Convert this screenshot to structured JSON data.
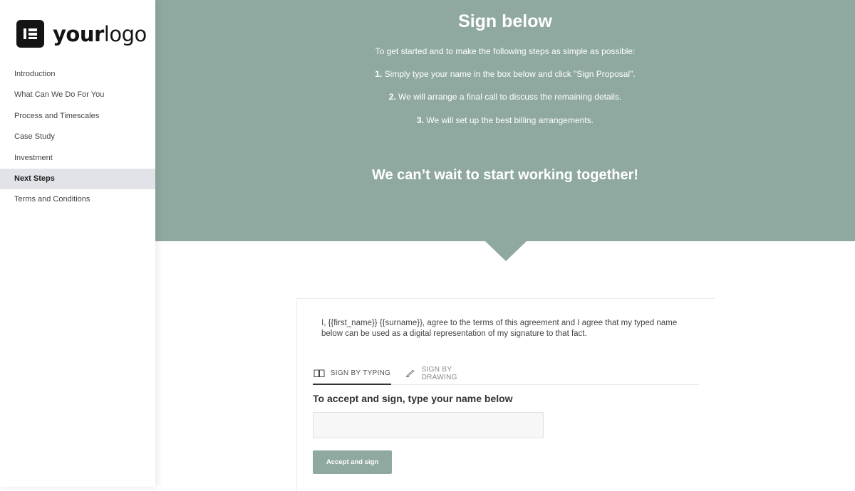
{
  "logo": {
    "text_bold": "your",
    "text_light": "logo"
  },
  "sidebar": {
    "items": [
      {
        "label": "Introduction",
        "active": false
      },
      {
        "label": "What Can We Do For You",
        "active": false
      },
      {
        "label": "Process and Timescales",
        "active": false
      },
      {
        "label": "Case Study",
        "active": false
      },
      {
        "label": "Investment",
        "active": false
      },
      {
        "label": "Next Steps",
        "active": true
      },
      {
        "label": "Terms and Conditions",
        "active": false
      }
    ]
  },
  "hero": {
    "title": "Sign below",
    "intro": "To get started and to make the following steps as simple as possible:",
    "steps": [
      {
        "num": "1.",
        "text": "Simply type your name in the box below and click \"Sign Proposal\"."
      },
      {
        "num": "2.",
        "text": "We will arrange a final call to discuss the remaining details."
      },
      {
        "num": "3.",
        "text": "We will set up the best billing arrangements."
      }
    ],
    "tagline": "We can’t wait to start working together!"
  },
  "sign": {
    "agreement": "I, {{first_name}} {{surname}}, agree to the terms of this agreement and I agree that my typed name below can be used as a digital representation of my signature to that fact.",
    "tab_typing": "SIGN BY TYPING",
    "tab_drawing": "SIGN BY DRAWING",
    "heading": "To accept and sign, type your name below",
    "input_value": "",
    "button_label": "Accept and sign"
  },
  "colors": {
    "accent": "#8fa9a1",
    "active_nav": "#e1e3e8",
    "logo_dark": "#141414"
  }
}
